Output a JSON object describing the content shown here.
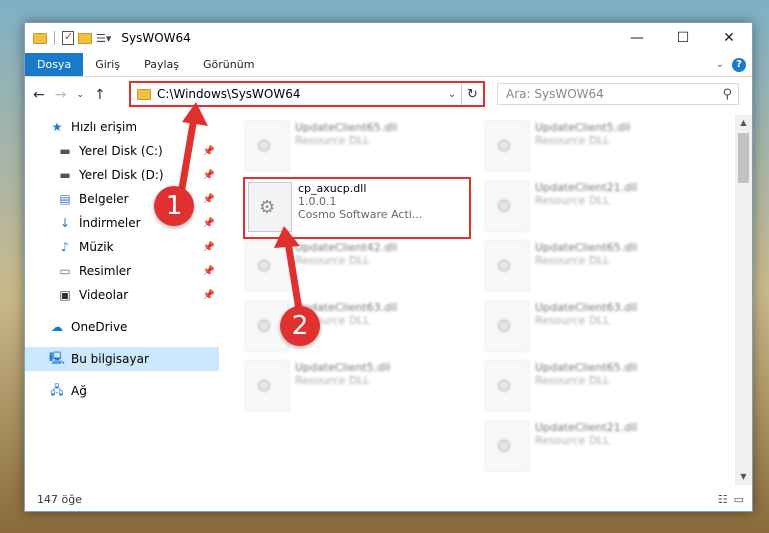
{
  "window": {
    "title": "SysWOW64"
  },
  "ribbon": {
    "tabs": [
      "Dosya",
      "Giriş",
      "Paylaş",
      "Görünüm"
    ]
  },
  "address": {
    "path": "C:\\Windows\\SysWOW64"
  },
  "search": {
    "placeholder": "Ara: SysWOW64"
  },
  "nav_pane": {
    "quick_access": "Hızlı erişim",
    "items": [
      "Yerel Disk (C:)",
      "Yerel Disk (D:)",
      "Belgeler",
      "İndirmeler",
      "Müzik",
      "Resimler",
      "Videolar"
    ],
    "onedrive": "OneDrive",
    "this_pc": "Bu bilgisayar",
    "network": "Ağ"
  },
  "files": {
    "highlighted": {
      "name": "cp_axucp.dll",
      "version": "1.0.0.1",
      "description": "Cosmo Software Acti..."
    },
    "blurred": [
      {
        "name": "UpdateClient65.dll",
        "sub": "Resource DLL"
      },
      {
        "name": "UpdateClient5.dll",
        "sub": "Resource DLL"
      },
      {
        "name": "UpdateClient21.dll",
        "sub": "Resource DLL"
      },
      {
        "name": "UpdateClient42.dll",
        "sub": "Resource DLL"
      },
      {
        "name": "UpdateClient65.dll",
        "sub": "Resource DLL"
      },
      {
        "name": "UpdateClient63.dll",
        "sub": "Resource DLL"
      },
      {
        "name": "UpdateClient63.dll",
        "sub": "Resource DLL"
      },
      {
        "name": "UpdateClient5.dll",
        "sub": "Resource DLL"
      },
      {
        "name": "UpdateClient65.dll",
        "sub": "Resource DLL"
      },
      {
        "name": "UpdateClient21.dll",
        "sub": "Resource DLL"
      }
    ]
  },
  "status": {
    "count": "147 öğe"
  },
  "annotations": {
    "step1": "1",
    "step2": "2"
  }
}
